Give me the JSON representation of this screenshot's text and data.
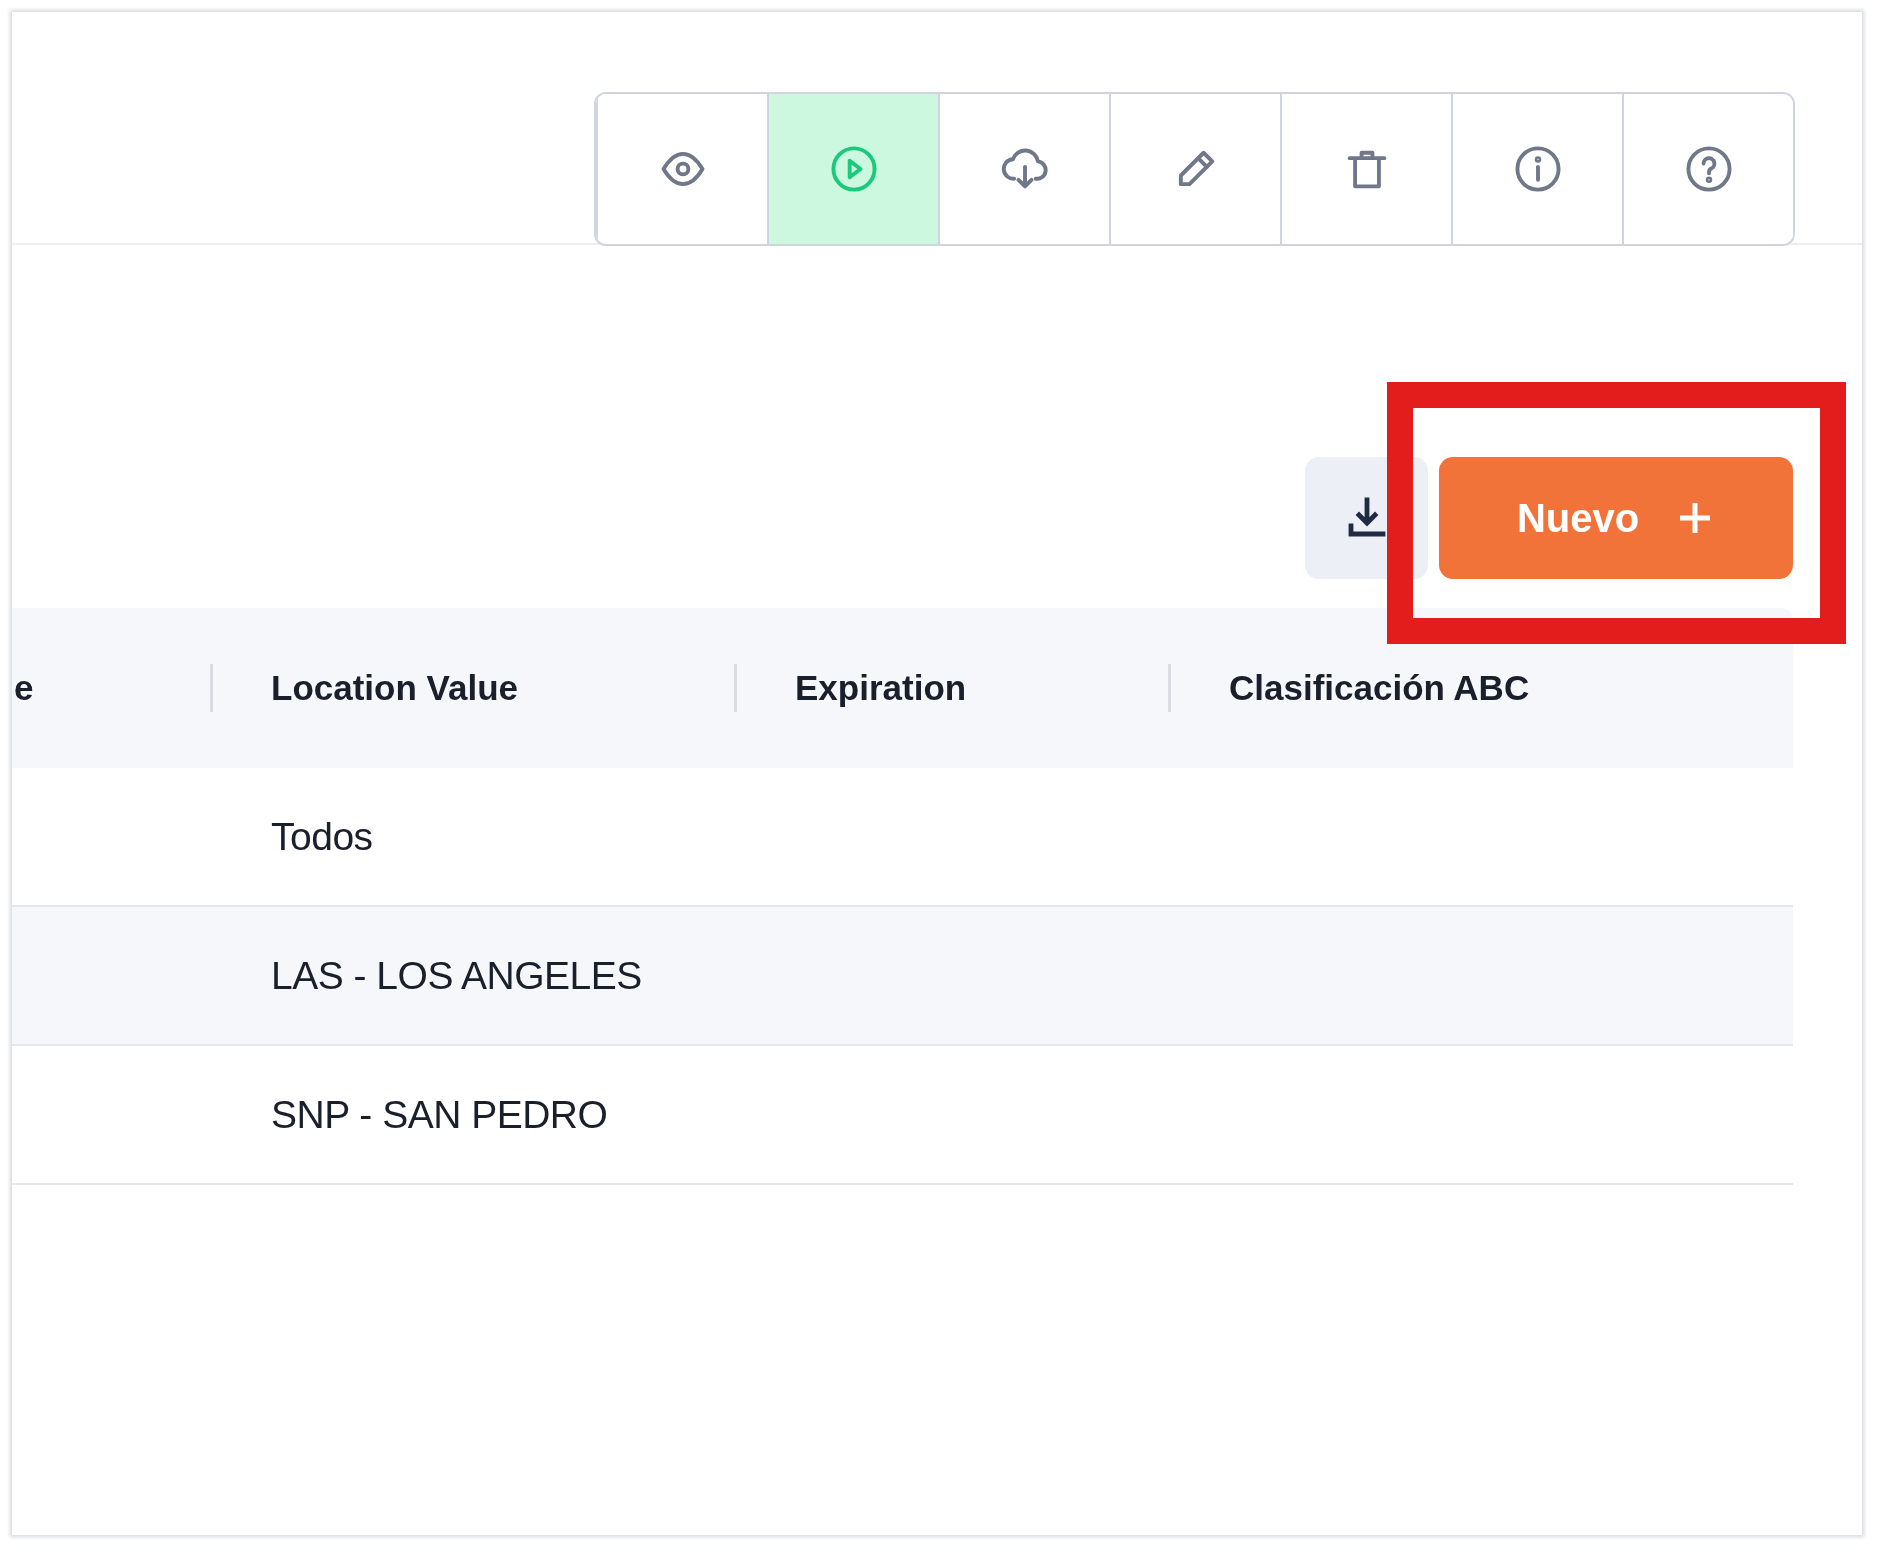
{
  "toolbar": [
    {
      "kind": "view",
      "selected": false
    },
    {
      "kind": "run",
      "selected": true
    },
    {
      "kind": "download",
      "selected": false
    },
    {
      "kind": "edit",
      "selected": false
    },
    {
      "kind": "delete",
      "selected": false
    },
    {
      "kind": "info",
      "selected": false
    },
    {
      "kind": "help",
      "selected": false
    }
  ],
  "actions": {
    "new_button": {
      "label": "Nuevo",
      "highlighted": true
    }
  },
  "table": {
    "columns": [
      "e",
      "Location Value",
      "Expiration",
      "Clasificación ABC"
    ],
    "rows": [
      {
        "location_value": "Todos"
      },
      {
        "location_value": "LAS - LOS ANGELES"
      },
      {
        "location_value": "SNP - SAN PEDRO"
      }
    ]
  }
}
